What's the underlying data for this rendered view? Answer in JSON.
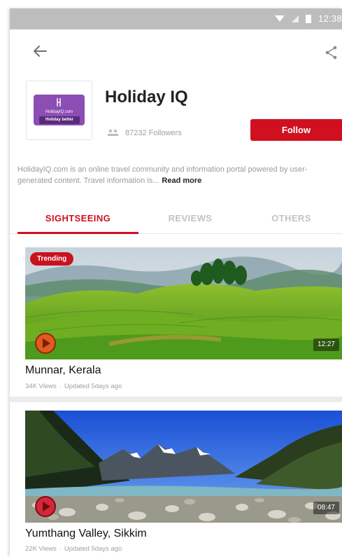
{
  "status_bar": {
    "time": "12:38"
  },
  "app_bar": {
    "back_icon": "arrow-left-icon",
    "share_icon": "share-icon"
  },
  "profile": {
    "name": "Holiday IQ",
    "logo": {
      "brand_text": "HolidayIQ.com",
      "tagline": "Holiday better"
    },
    "followers_text": "87232 Followers",
    "follow_label": "Follow",
    "description": "HolidayIQ.com is an online travel community and information portal powered by user-generated content. Travel information is...",
    "read_more_label": "Read more"
  },
  "tabs": [
    {
      "label": "SIGHTSEEING",
      "active": true
    },
    {
      "label": "REVIEWS",
      "active": false
    },
    {
      "label": "OTHERS",
      "active": false
    }
  ],
  "videos": [
    {
      "badge": "Trending",
      "title": "Munnar, Kerala",
      "views": "34K Views",
      "updated": "Updated 5days ago",
      "duration": "12:27"
    },
    {
      "badge": "",
      "title": "Yumthang Valley, Sikkim",
      "views": "22K Views",
      "updated": "Updated 5days ago",
      "duration": "08:47"
    }
  ],
  "colors": {
    "accent": "#d0101f",
    "logo_purple": "#8c4db5",
    "status_bar": "#bdbdbd"
  }
}
